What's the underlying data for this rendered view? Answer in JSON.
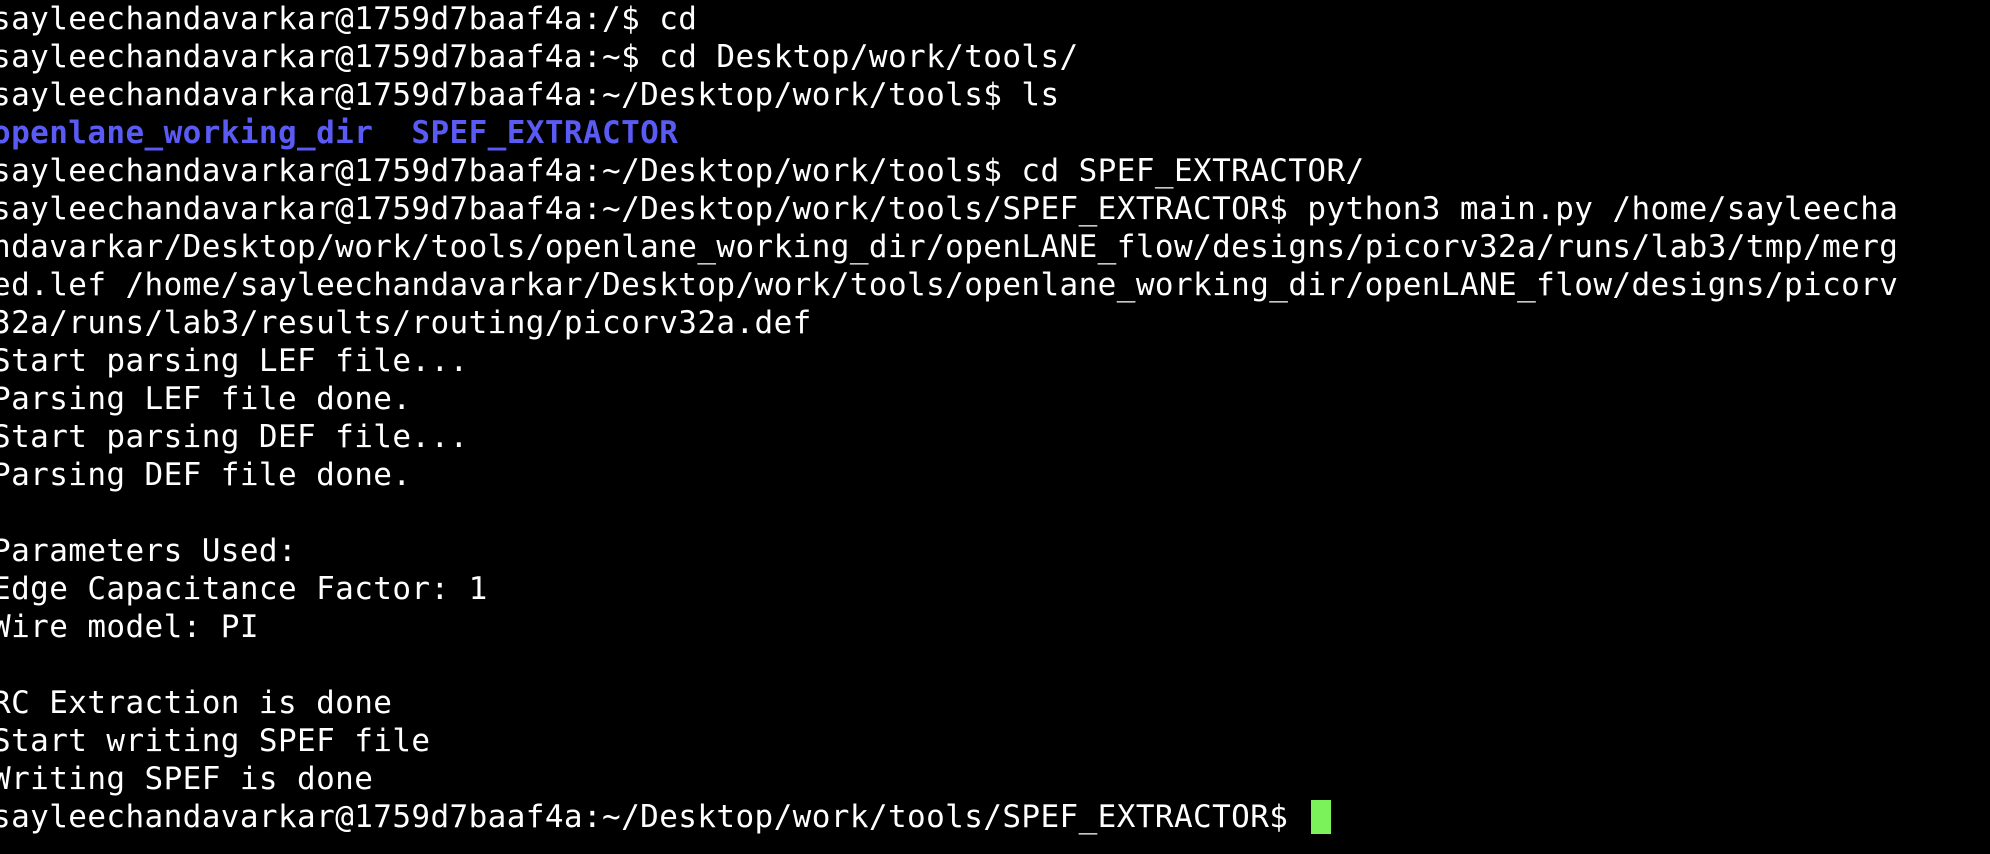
{
  "colors": {
    "background": "#000000",
    "foreground": "#ffffff",
    "directory": "#5a5af5",
    "cursor": "#7cf25a"
  },
  "lines": [
    "sayleechandavarkar@1759d7baaf4a:/$ cd",
    "sayleechandavarkar@1759d7baaf4a:~$ cd Desktop/work/tools/",
    "sayleechandavarkar@1759d7baaf4a:~/Desktop/work/tools$ ls",
    "",
    "sayleechandavarkar@1759d7baaf4a:~/Desktop/work/tools$ cd SPEF_EXTRACTOR/",
    "sayleechandavarkar@1759d7baaf4a:~/Desktop/work/tools/SPEF_EXTRACTOR$ python3 main.py /home/sayleecha",
    "ndavarkar/Desktop/work/tools/openlane_working_dir/openLANE_flow/designs/picorv32a/runs/lab3/tmp/merg",
    "ed.lef /home/sayleechandavarkar/Desktop/work/tools/openlane_working_dir/openLANE_flow/designs/picorv",
    "32a/runs/lab3/results/routing/picorv32a.def",
    "Start parsing LEF file...",
    "Parsing LEF file done.",
    "Start parsing DEF file...",
    "Parsing DEF file done.",
    "",
    "Parameters Used:",
    "Edge Capacitance Factor: 1",
    "Wire model: PI",
    "",
    "RC Extraction is done",
    "Start writing SPEF file",
    "Writing SPEF is done",
    "sayleechandavarkar@1759d7baaf4a:~/Desktop/work/tools/SPEF_EXTRACTOR$ "
  ],
  "ls_output": {
    "dir1": "openlane_working_dir",
    "dir2": "SPEF_EXTRACTOR"
  }
}
